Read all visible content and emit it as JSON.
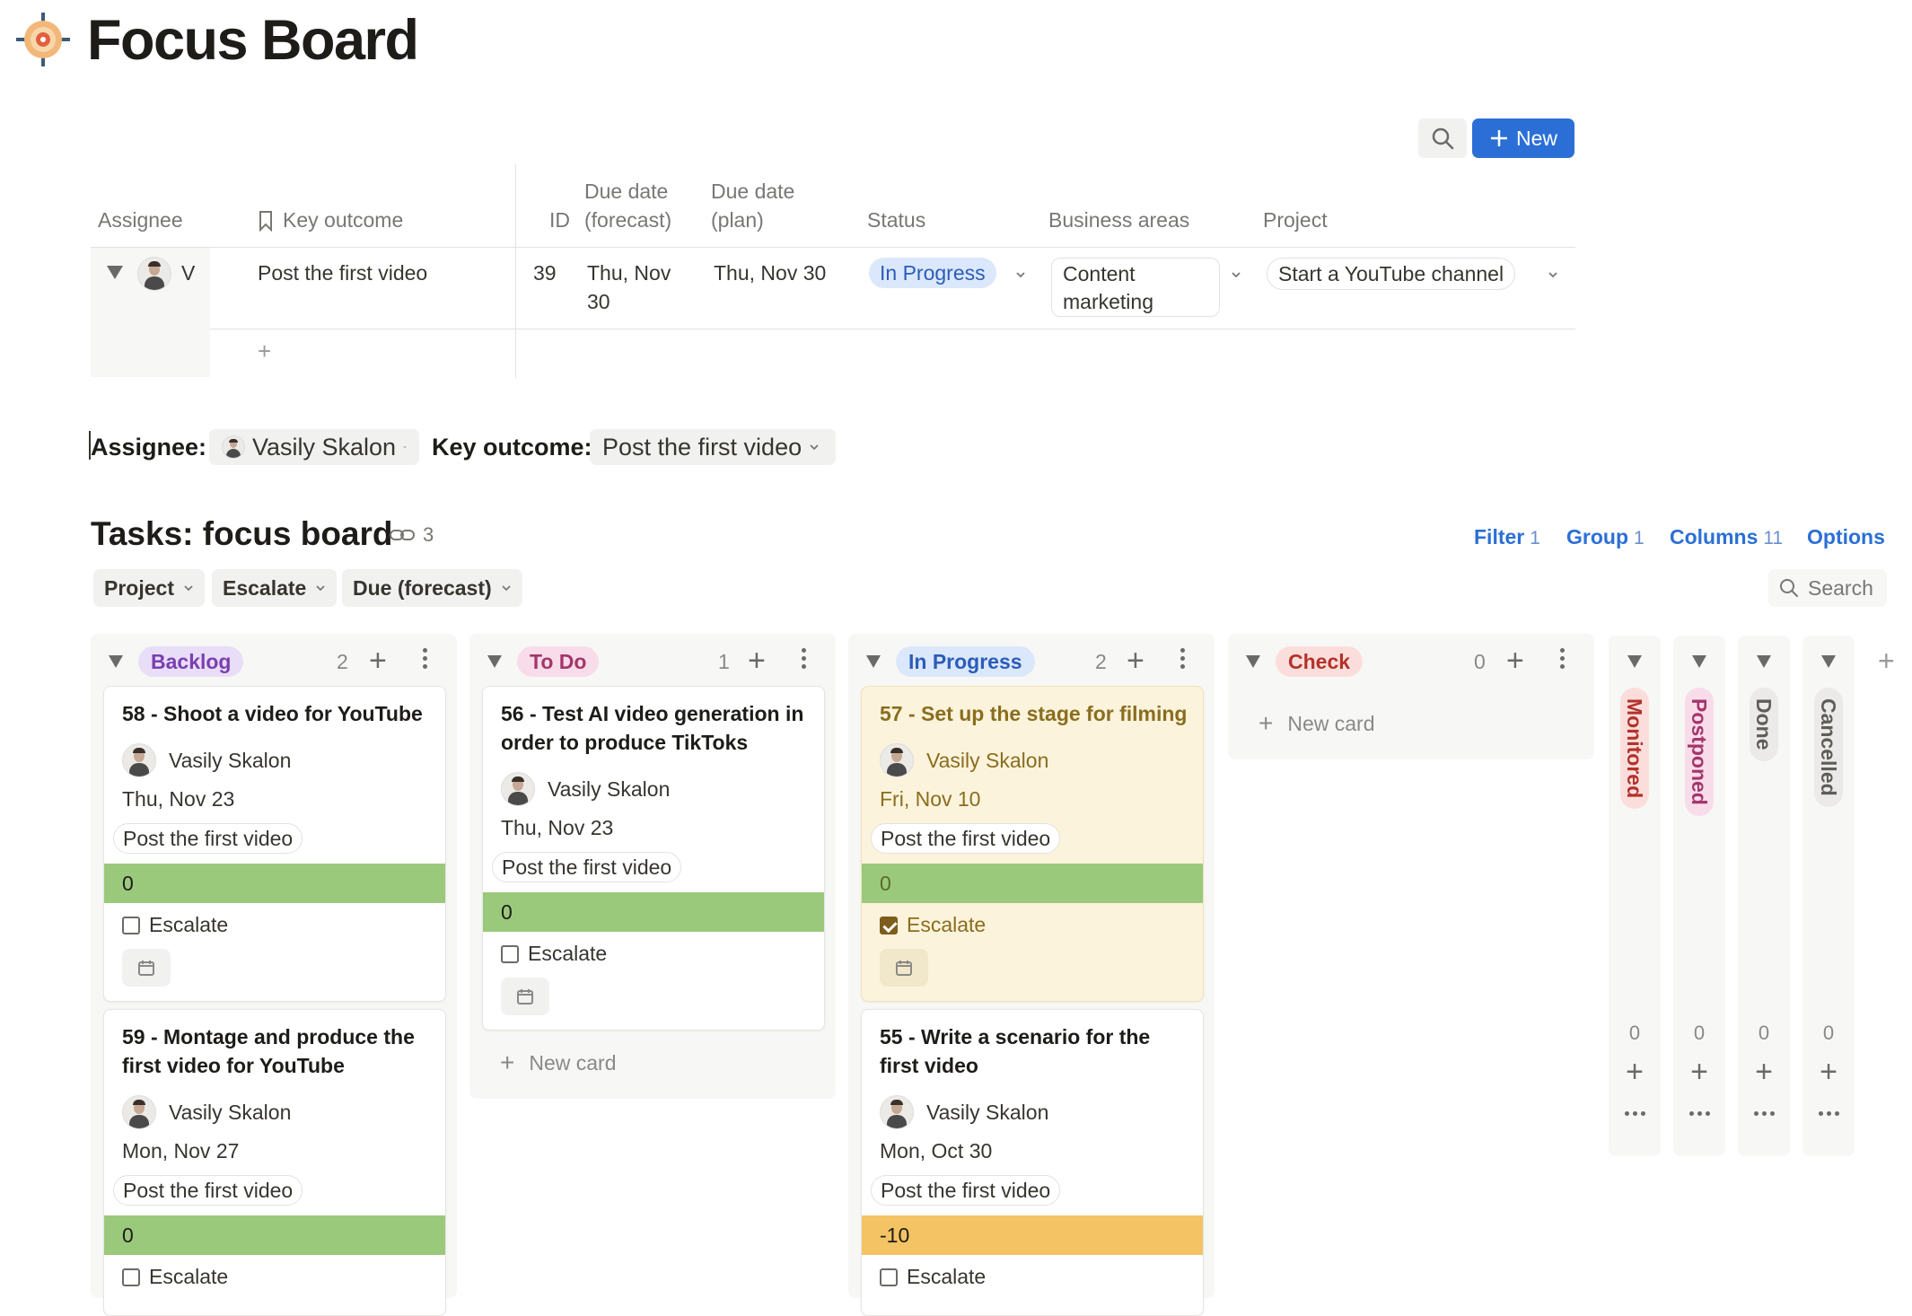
{
  "page": {
    "title": "Focus Board"
  },
  "toolbar": {
    "new_label": "New"
  },
  "table": {
    "headers": {
      "assignee": "Assignee",
      "key_outcome": "Key outcome",
      "id": "ID",
      "due_forecast_1": "Due date",
      "due_forecast_2": "(forecast)",
      "due_plan_1": "Due date",
      "due_plan_2": "(plan)",
      "status": "Status",
      "business_areas": "Business areas",
      "project": "Project"
    },
    "row": {
      "assignee_initial": "V",
      "key_outcome": "Post the first video",
      "id": "39",
      "due_forecast_1": "Thu, Nov",
      "due_forecast_2": "30",
      "due_plan": "Thu, Nov 30",
      "status": "In Progress",
      "business_area_1": "Content",
      "business_area_2": "marketing",
      "project": "Start a YouTube channel"
    },
    "add_row": "+"
  },
  "filters": {
    "assignee_label": "Assignee:",
    "assignee_value": "Vasily Skalon",
    "key_outcome_label": "Key outcome:",
    "key_outcome_value": "Post the first video"
  },
  "tasks": {
    "title": "Tasks: focus board",
    "link_count": "3",
    "options": {
      "filter": "Filter",
      "filter_count": "1",
      "group": "Group",
      "group_count": "1",
      "columns": "Columns",
      "columns_count": "11",
      "options": "Options"
    },
    "group_chips": [
      "Project",
      "Escalate",
      "Due (forecast)"
    ],
    "search": "Search",
    "new_card": "New card",
    "escalate_label": "Escalate"
  },
  "columns": [
    {
      "label": "Backlog",
      "count": "2",
      "color": "#e8def8",
      "text_color": "#7b3fb0",
      "cards": [
        {
          "title": "58 - Shoot a video for YouTube",
          "assignee": "Vasily Skalon",
          "date": "Thu, Nov 23",
          "key_outcome": "Post the first video",
          "delta": "0",
          "escalate": false
        },
        {
          "title": "59 - Montage and produce the first video for YouTube",
          "assignee": "Vasily Skalon",
          "date": "Mon, Nov 27",
          "key_outcome": "Post the first video",
          "delta": "0",
          "escalate": false
        }
      ]
    },
    {
      "label": "To Do",
      "count": "1",
      "color": "#f9dcea",
      "text_color": "#a3366b",
      "cards": [
        {
          "title": "56 - Test AI video generation in order to produce TikToks",
          "assignee": "Vasily Skalon",
          "date": "Thu, Nov 23",
          "key_outcome": "Post the first video",
          "delta": "0",
          "escalate": false
        }
      ]
    },
    {
      "label": "In Progress",
      "count": "2",
      "color": "#dbe8fb",
      "text_color": "#2b5cb8",
      "cards": [
        {
          "title": "57 - Set up the stage for filming",
          "assignee": "Vasily Skalon",
          "date": "Fri, Nov 10",
          "key_outcome": "Post the first video",
          "delta": "0",
          "escalate": true
        },
        {
          "title": "55 - Write a scenario for the first video",
          "assignee": "Vasily Skalon",
          "date": "Mon, Oct 30",
          "key_outcome": "Post the first video",
          "delta": "-10",
          "escalate": false
        }
      ]
    },
    {
      "label": "Check",
      "count": "0",
      "color": "#fbdedc",
      "text_color": "#b3322b",
      "cards": []
    }
  ],
  "collapsed_columns": [
    {
      "label": "Monitored",
      "count": "0",
      "color": "#fbdedc",
      "text_color": "#b3322b"
    },
    {
      "label": "Postponed",
      "count": "0",
      "color": "#f9dcea",
      "text_color": "#a3366b"
    },
    {
      "label": "Done",
      "count": "0",
      "color": "#ebeae8",
      "text_color": "#5e5d59"
    },
    {
      "label": "Cancelled",
      "count": "0",
      "color": "#ebeae8",
      "text_color": "#5e5d59"
    }
  ]
}
